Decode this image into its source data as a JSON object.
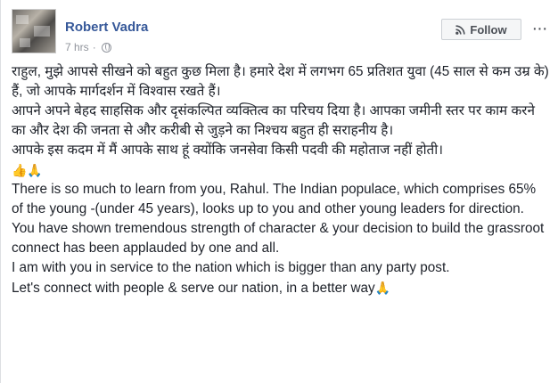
{
  "post": {
    "author": "Robert Vadra",
    "timestamp": "7 hrs",
    "separator": "·",
    "privacy_icon": "globe-icon",
    "follow_label": "Follow",
    "more_label": "···",
    "hindi_lines": [
      "राहुल, मुझे आपसे सीखने को बहुत कुछ मिला है। हमारे देश में लगभग 65 प्रतिशत युवा (45 साल से कम उम्र के) हैं, जो आपके मार्गदर्शन में विश्वास रखते हैं।",
      "आपने अपने बेहद साहसिक और दृसंकल्पित व्यक्तित्व का परिचय दिया है। आपका जमीनी स्तर पर काम करने का और देश की जनता से और करीबी से जुड़ने का निश्चय बहुत ही सराहनीय है।",
      "आपके इस कदम में मैं आपके साथ हूं क्योंकि जनसेवा किसी पदवी की महोताज नहीं होती।"
    ],
    "hindi_emoji": "👍🙏",
    "english_lines": [
      "There is so much to learn from you, Rahul. The Indian populace, which comprises 65% of the young -(under 45 years), looks up to you and other young leaders for direction.",
      "You have shown tremendous strength of character & your decision to build the grassroot connect has been applauded by one and all.",
      "I am with you in service to the nation which is bigger than any party post.",
      "Let's connect with people & serve our nation, in a better way"
    ],
    "closing_emoji": "🙏"
  }
}
